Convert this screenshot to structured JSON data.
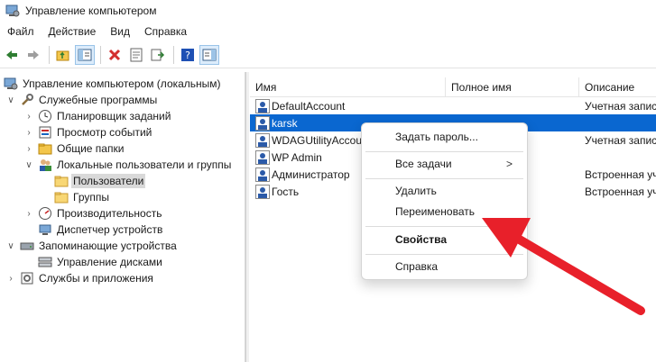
{
  "window": {
    "title": "Управление компьютером"
  },
  "menu": [
    "Файл",
    "Действие",
    "Вид",
    "Справка"
  ],
  "toolbar": {
    "buttons": [
      "back-icon",
      "forward-icon",
      "up-folder-icon",
      "show-hide-tree-icon",
      "delete-icon",
      "properties-icon",
      "export-list-icon",
      "help-icon",
      "show-action-pane-icon"
    ]
  },
  "tree": {
    "items": [
      {
        "label": "Управление компьютером (локальным)"
      },
      {
        "label": "Служебные программы"
      },
      {
        "label": "Планировщик заданий"
      },
      {
        "label": "Просмотр событий"
      },
      {
        "label": "Общие папки"
      },
      {
        "label": "Локальные пользователи и группы"
      },
      {
        "label": "Пользователи"
      },
      {
        "label": "Группы"
      },
      {
        "label": "Производительность"
      },
      {
        "label": "Диспетчер устройств"
      },
      {
        "label": "Запоминающие устройства"
      },
      {
        "label": "Управление дисками"
      },
      {
        "label": "Службы и приложения"
      }
    ]
  },
  "list": {
    "columns": [
      "Имя",
      "Полное имя",
      "Описание"
    ],
    "rows": [
      {
        "name": "DefaultAccount",
        "full_name": "",
        "description": "Учетная запис"
      },
      {
        "name": "karsk",
        "full_name": "",
        "description": ""
      },
      {
        "name": "WDAGUtilityAccou",
        "full_name": "",
        "description": "Учетная запис"
      },
      {
        "name": "WP Admin",
        "full_name": "",
        "description": ""
      },
      {
        "name": "Администратор",
        "full_name": "",
        "description": "Встроенная уч"
      },
      {
        "name": "Гость",
        "full_name": "",
        "description": "Встроенная уч"
      }
    ]
  },
  "context_menu": {
    "items": [
      {
        "label": "Задать пароль..."
      },
      {
        "label": "Все задачи"
      },
      {
        "label": "Удалить"
      },
      {
        "label": "Переименовать"
      },
      {
        "label": "Свойства"
      },
      {
        "label": "Справка"
      }
    ],
    "submenu_arrow": ">"
  },
  "colors": {
    "selection": "#0a67d0",
    "annotation_arrow": "#e8202a"
  }
}
